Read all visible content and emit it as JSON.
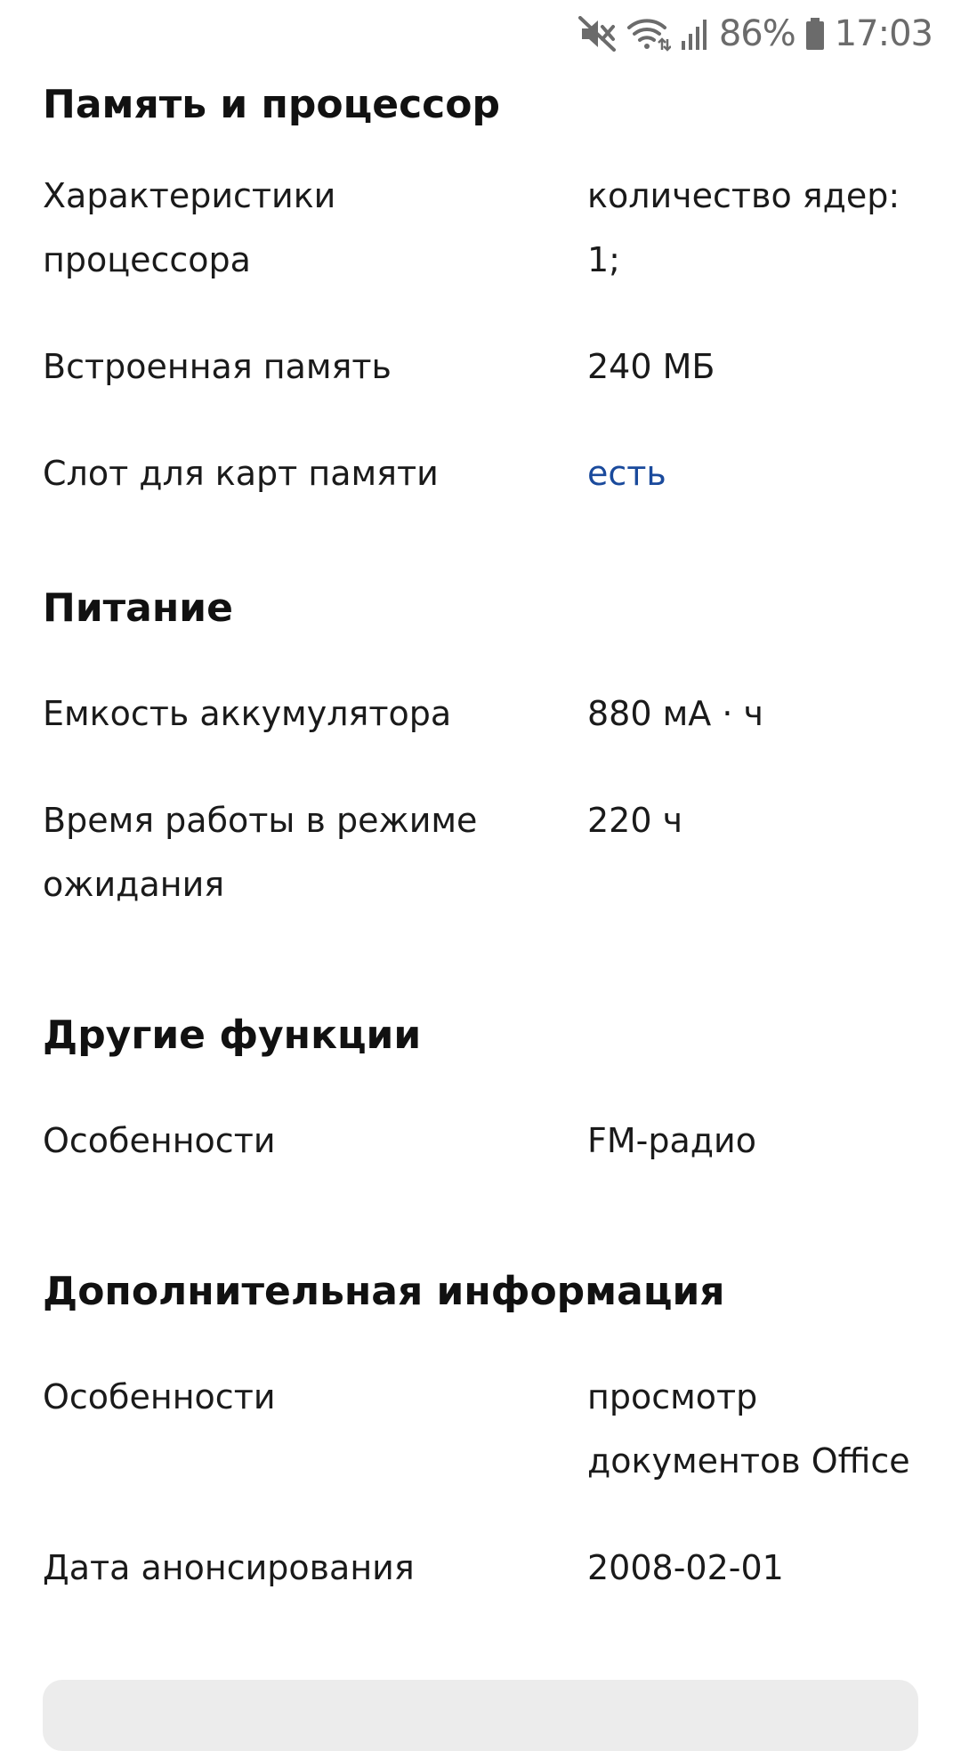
{
  "status_bar": {
    "battery_percent": "86%",
    "time": "17:03",
    "icons": [
      "mute-icon",
      "wifi-icon",
      "signal-icon",
      "battery-icon"
    ]
  },
  "sections": {
    "memory": {
      "title": "Память и процессор",
      "rows": [
        {
          "label_1": "Характеристики",
          "label_2": "процессора",
          "value_1": "количество ядер:",
          "value_2": "1;"
        },
        {
          "label": "Встроенная память",
          "value": "240 МБ"
        },
        {
          "label": "Слот для карт памяти",
          "value": "есть"
        }
      ]
    },
    "power": {
      "title": "Питание",
      "rows": [
        {
          "label": "Емкость аккумулятора",
          "value": "880 мА · ч"
        },
        {
          "label_1": "Время работы в режиме",
          "label_2": "ожидания",
          "value": "220 ч"
        }
      ]
    },
    "other": {
      "title": "Другие функции",
      "rows": [
        {
          "label": "Особенности",
          "value": "FM-радио"
        }
      ]
    },
    "extra": {
      "title": "Дополнительная информация",
      "rows": [
        {
          "label": "Особенности",
          "value_1": "просмотр",
          "value_2": "документов Office"
        },
        {
          "label": "Дата анонсирования",
          "value": "2008-02-01"
        }
      ]
    }
  },
  "colors": {
    "link": "#1a4a9c",
    "text": "#1a1a1a",
    "status_text": "#6b6b6b",
    "card_bg": "#ececec"
  }
}
